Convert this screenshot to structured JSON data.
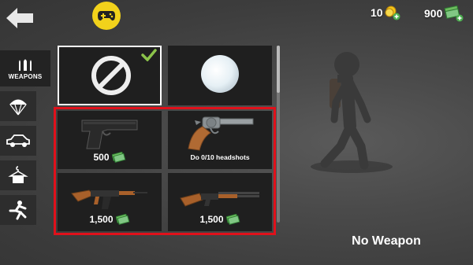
{
  "header": {
    "back_icon": "back-arrow-icon",
    "gamepad_icon": "gamepad-icon",
    "coins": "10",
    "cash": "900"
  },
  "sidebar": {
    "tabs": [
      {
        "label": "WEAPONS",
        "icon": "bullets-icon",
        "active": true
      },
      {
        "label": "",
        "icon": "parachute-icon"
      },
      {
        "label": "",
        "icon": "car-icon"
      },
      {
        "label": "",
        "icon": "shirt-icon"
      },
      {
        "label": "",
        "icon": "pose-icon"
      }
    ]
  },
  "grid": {
    "items": [
      {
        "name": "none",
        "icon": "no-weapon-icon",
        "selected": true,
        "equipped": true
      },
      {
        "name": "snowball",
        "icon": "snowball-icon"
      },
      {
        "name": "pistol",
        "price": "500"
      },
      {
        "name": "revolver",
        "requirement": "Do 0/10 headshots"
      },
      {
        "name": "ak47",
        "price": "1,500"
      },
      {
        "name": "shotgun",
        "price": "1,500"
      }
    ]
  },
  "preview": {
    "status": "No Weapon"
  },
  "colors": {
    "highlight": "#e0111b",
    "gamepad": "#f2d21b",
    "check": "#8bc34a",
    "cash": "#4caf50"
  }
}
